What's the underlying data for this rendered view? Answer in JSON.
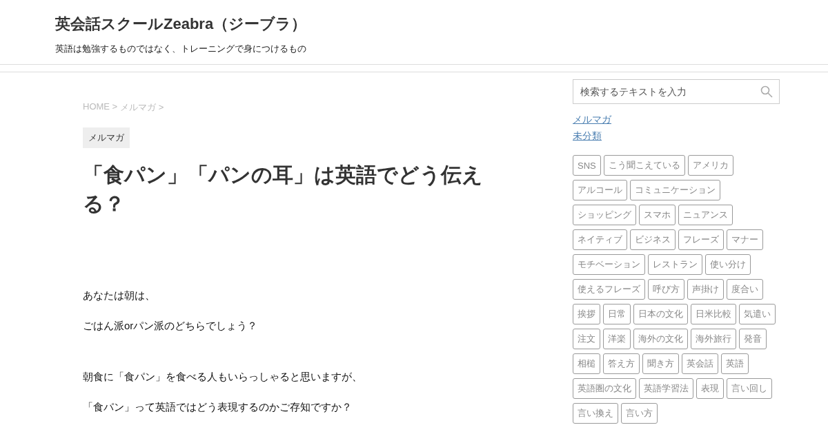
{
  "site": {
    "title": "英会話スクールZeabra（ジーブラ）",
    "tagline": "英語は勉強するものではなく、トレーニングで身につけるもの"
  },
  "breadcrumb": [
    "HOME >",
    "メルマガ >"
  ],
  "category": "メルマガ",
  "article": {
    "title": "「食パン」「パンの耳」は英語でどう伝える？",
    "sections": [
      [
        "あなたは朝は、",
        "ごはん派orパン派のどちらでしょう？"
      ],
      [
        "朝食に「食パン」を食べる人もいらっしゃると思いますが、",
        "「食パン」って英語ではどう表現するのかご存知ですか？"
      ]
    ]
  },
  "sidebar": {
    "search": {
      "placeholder": "検索するテキストを入力"
    },
    "categories": [
      "メルマガ",
      "未分類"
    ],
    "tags": [
      "SNS",
      "こう聞こえている",
      "アメリカ",
      "アルコール",
      "コミュニケーション",
      "ショッピング",
      "スマホ",
      "ニュアンス",
      "ネイティブ",
      "ビジネス",
      "フレーズ",
      "マナー",
      "モチベーション",
      "レストラン",
      "使い分け",
      "使えるフレーズ",
      "呼び方",
      "声掛け",
      "度合い",
      "挨拶",
      "日常",
      "日本の文化",
      "日米比較",
      "気遣い",
      "注文",
      "洋楽",
      "海外の文化",
      "海外旅行",
      "発音",
      "相槌",
      "答え方",
      "聞き方",
      "英会話",
      "英語",
      "英語圏の文化",
      "英語学習法",
      "表現",
      "言い回し",
      "言い換え",
      "言い方"
    ]
  }
}
